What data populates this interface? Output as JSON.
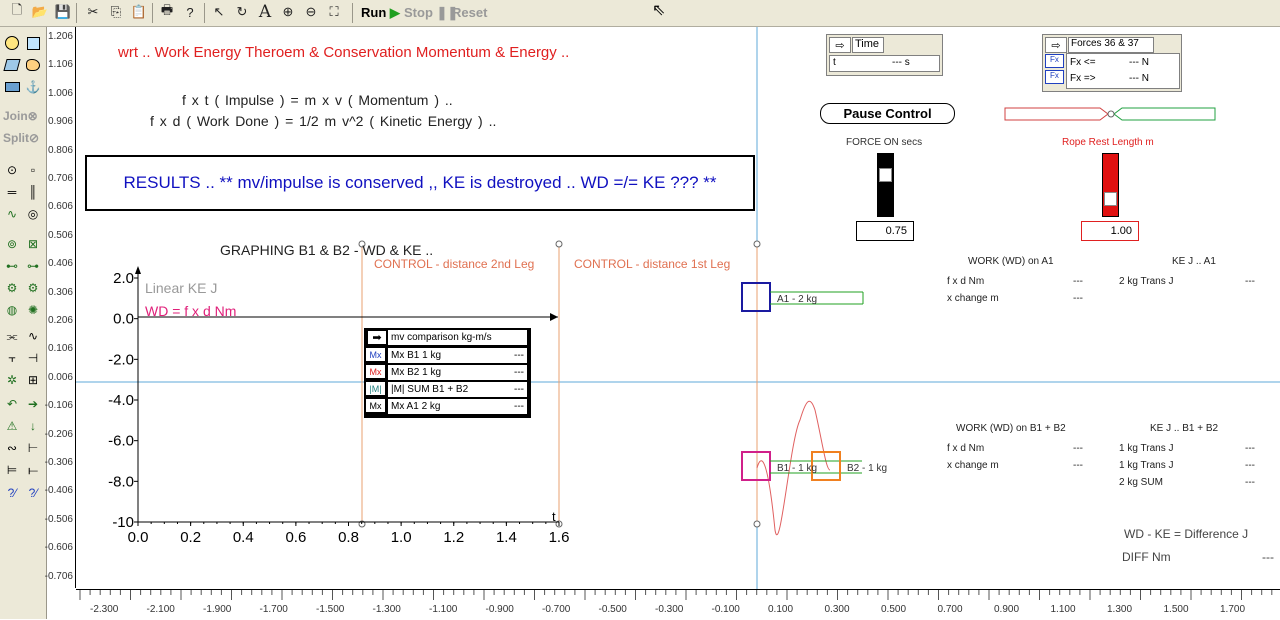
{
  "toolbar": {
    "run": "Run",
    "stop": "Stop",
    "reset": "Reset"
  },
  "palette": {
    "join": "Join",
    "split": "Split"
  },
  "ruler_left": [
    "1.206",
    "1.106",
    "1.006",
    "0.906",
    "0.806",
    "0.706",
    "0.606",
    "0.506",
    "0.406",
    "0.306",
    "0.206",
    "0.106",
    "0.006",
    "-0.106",
    "-0.206",
    "-0.306",
    "-0.406",
    "-0.506",
    "-0.606",
    "-0.706"
  ],
  "ruler_bottom": [
    "-2.300",
    "-2.100",
    "-1.900",
    "-1.700",
    "-1.500",
    "-1.300",
    "-1.100",
    "-0.900",
    "-0.700",
    "-0.500",
    "-0.300",
    "-0.100",
    "0.100",
    "0.300",
    "0.500",
    "0.700",
    "0.900",
    "1.100",
    "1.300",
    "1.500",
    "1.700"
  ],
  "header": {
    "title": "wrt .. Work Energy Theroem & Conservation Momentum & Energy ..",
    "eq1": "f x t  ( Impulse )  =  m x v  ( Momentum )  ..",
    "eq2": "f x d  ( Work Done )  =  1/2 m v^2  ( Kinetic Energy )  .."
  },
  "results": "RESULTS .. ** mv/impulse is conserved ,, KE is destroyed .. WD =/= KE ??? **",
  "graph": {
    "title": "GRAPHING B1 & B2 - WD & KE ..",
    "legend_ke": "Linear KE J",
    "legend_wd": "WD = f x d Nm",
    "t_label": "t",
    "control2": "CONTROL - distance 2nd Leg",
    "control1": "CONTROL - distance 1st Leg"
  },
  "chart_data": {
    "type": "line",
    "xlabel": "t",
    "ylabel": "",
    "xlim": [
      0.0,
      1.6
    ],
    "ylim": [
      -10,
      2.0
    ],
    "x_ticks": [
      "0.0",
      "0.2",
      "0.4",
      "0.6",
      "0.8",
      "1.0",
      "1.2",
      "1.4",
      "1.6"
    ],
    "y_ticks": [
      "2.0",
      "0.0",
      "-2.0",
      "-4.0",
      "-6.0",
      "-8.0",
      "-10"
    ],
    "series": [
      {
        "name": "Linear KE J",
        "color": "#808080",
        "x": [],
        "y": []
      },
      {
        "name": "WD = f x d Nm",
        "color": "#e0207a",
        "x": [],
        "y": []
      }
    ]
  },
  "mv_panel": {
    "title": "mv comparison kg-m/s",
    "rows": [
      {
        "icon": "Mx",
        "label": "Mx B1 1 kg",
        "value": "---",
        "color": "#2040c0"
      },
      {
        "icon": "Mx",
        "label": "Mx B2 1 kg",
        "value": "---",
        "color": "#e02020"
      },
      {
        "icon": "|M|",
        "label": "|M| SUM B1 + B2",
        "value": "---",
        "color": "#208080"
      },
      {
        "icon": "Mx",
        "label": "Mx A1 2 kg",
        "value": "---",
        "color": "#000000"
      }
    ]
  },
  "time_panel": {
    "title": "Time",
    "var": "t",
    "value": "--- s"
  },
  "forces_panel": {
    "title": "Forces 36 & 37",
    "rows": [
      {
        "icon": "Fx",
        "label": "Fx <=",
        "value": "--- N"
      },
      {
        "icon": "Fx",
        "label": "Fx =>",
        "value": "--- N"
      }
    ]
  },
  "pause_button": "Pause Control",
  "force_on": {
    "label": "FORCE ON secs",
    "value": "0.75"
  },
  "rope": {
    "label": "Rope Rest Length m",
    "value": "1.00"
  },
  "work_a1": {
    "title": "WORK (WD) on A1",
    "rows": [
      {
        "label": "f x d Nm",
        "value": "---"
      },
      {
        "label": "x change m",
        "value": "---"
      }
    ]
  },
  "ke_a1": {
    "title": "KE J .. A1",
    "rows": [
      {
        "label": "2 kg Trans J",
        "value": "---"
      }
    ]
  },
  "work_b": {
    "title": "WORK (WD) on B1 + B2",
    "rows": [
      {
        "label": "f x d Nm",
        "value": "---"
      },
      {
        "label": "x change m",
        "value": "---"
      }
    ]
  },
  "ke_b": {
    "title": "KE J .. B1 + B2",
    "rows": [
      {
        "label": "1 kg Trans J",
        "value": "---"
      },
      {
        "label": "1 kg Trans J",
        "value": "---"
      },
      {
        "label": "2 kg SUM",
        "value": "---"
      }
    ]
  },
  "diff": {
    "line1": "WD - KE  =  Difference  J",
    "line2": "DIFF Nm",
    "value": "---"
  },
  "bodies": {
    "a1": "A1 - 2 kg",
    "b1": "B1 - 1 kg",
    "b2": "B2 - 1 kg"
  },
  "colors": {
    "header_red": "#e02020",
    "results_blue": "#1010c0",
    "axis_blue": "#5fa8d8",
    "control_orange": "#e8a070",
    "a1_blue": "#1a1aa0",
    "b1_magenta": "#d0208a",
    "b2_orange": "#f08020"
  }
}
